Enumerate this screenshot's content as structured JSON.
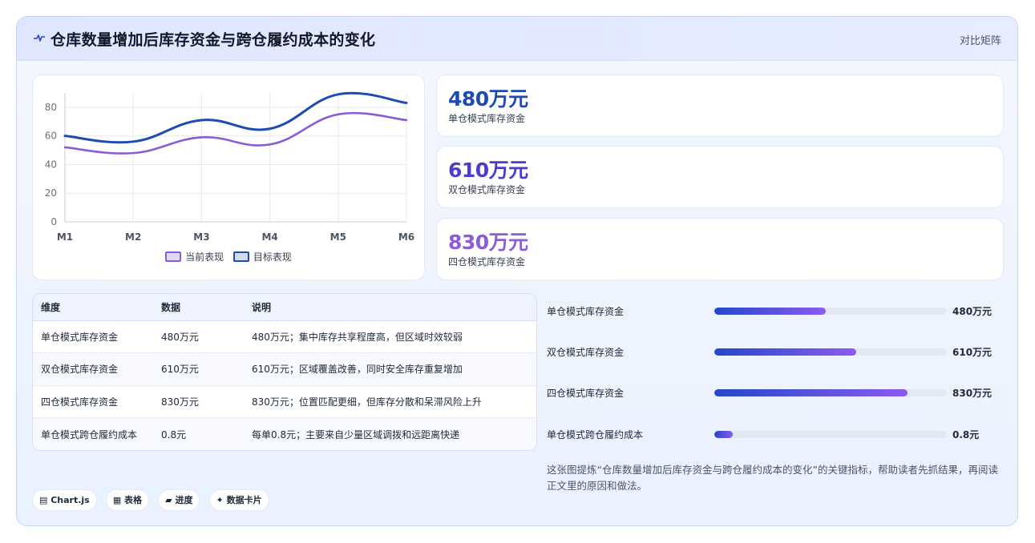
{
  "header": {
    "title": "仓库数量增加后库存资金与跨仓履约成本的变化",
    "right_label": "对比矩阵",
    "icon": "pulse-icon"
  },
  "chart_data": {
    "type": "line",
    "categories": [
      "M1",
      "M2",
      "M3",
      "M4",
      "M5",
      "M6"
    ],
    "series": [
      {
        "name": "当前表现",
        "values": [
          52,
          48,
          59,
          54,
          75,
          71
        ],
        "color": "#8b5cd6"
      },
      {
        "name": "目标表现",
        "values": [
          60,
          56,
          71,
          65,
          89,
          83
        ],
        "color": "#1e4ab3"
      }
    ],
    "y_ticks": [
      "0",
      "20",
      "40",
      "60",
      "80"
    ],
    "ylim": [
      0,
      90
    ],
    "grid": true,
    "legend": "bottom"
  },
  "kpis": [
    {
      "value": "480万元",
      "label": "单仓模式库存资金",
      "color": "#1e4ab3"
    },
    {
      "value": "610万元",
      "label": "双仓模式库存资金",
      "color": "#4b3ccf"
    },
    {
      "value": "830万元",
      "label": "四仓模式库存资金",
      "color": "#8b5cd6"
    }
  ],
  "table": {
    "headers": [
      "维度",
      "数据",
      "说明"
    ],
    "rows": [
      [
        "单仓模式库存资金",
        "480万元",
        "480万元；集中库存共享程度高，但区域时效较弱"
      ],
      [
        "双仓模式库存资金",
        "610万元",
        "610万元；区域覆盖改善，同时安全库存重复增加"
      ],
      [
        "四仓模式库存资金",
        "830万元",
        "830万元；位置匹配更细，但库存分散和呆滞风险上升"
      ],
      [
        "单仓模式跨仓履约成本",
        "0.8元",
        "每单0.8元；主要来自少量区域调拨和远距离快递"
      ]
    ]
  },
  "progress": [
    {
      "label": "单仓模式库存资金",
      "value": "480万元",
      "fraction": 0.48
    },
    {
      "label": "双仓模式库存资金",
      "value": "610万元",
      "fraction": 0.61
    },
    {
      "label": "四仓模式库存资金",
      "value": "830万元",
      "fraction": 0.83
    },
    {
      "label": "单仓模式跨仓履约成本",
      "value": "0.8元",
      "fraction": 0.08
    }
  ],
  "description": "这张图提炼“仓库数量增加后库存资金与跨仓履约成本的变化”的关键指标，帮助读者先抓结果，再阅读正文里的原因和做法。",
  "chips": [
    "▤ Chart.js",
    "▦ 表格",
    "▰ 进度",
    "✦ 数据卡片"
  ]
}
